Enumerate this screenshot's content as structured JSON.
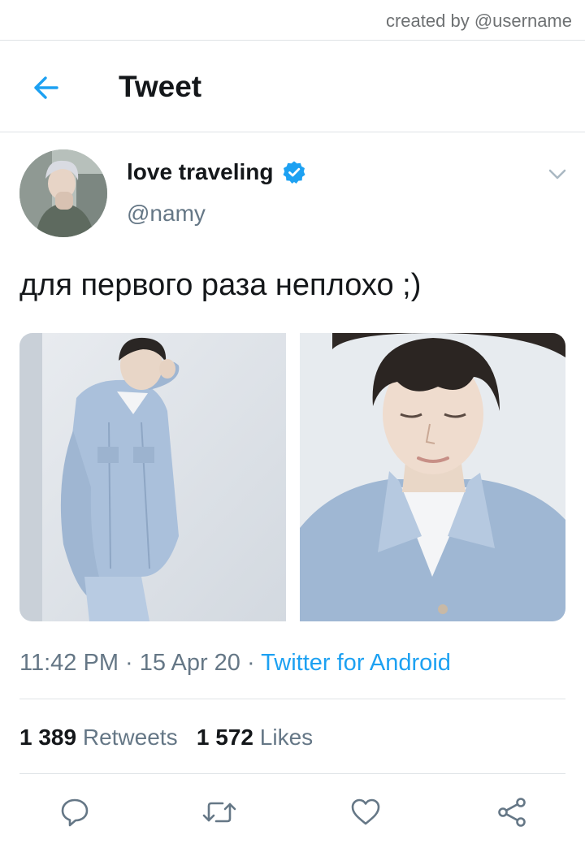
{
  "watermark": "created by @username",
  "header": {
    "title": "Tweet"
  },
  "tweet": {
    "display_name": "love traveling",
    "handle": "@namy",
    "text": "для первого раза неплохо ;)",
    "time": "11:42 PM",
    "date": "15 Apr 20",
    "source": "Twitter for Android",
    "separator": " · "
  },
  "stats": {
    "retweets_count": "1 389",
    "retweets_label": "Retweets",
    "likes_count": "1 572",
    "likes_label": "Likes"
  },
  "colors": {
    "accent": "#1da1f2",
    "secondary_text": "#657786",
    "divider": "#dfe3e6",
    "verified": "#1da1f2"
  },
  "icons": {
    "back": "arrow-left-icon",
    "verified": "verified-badge-icon",
    "caret": "chevron-down-icon",
    "reply": "reply-icon",
    "retweet": "retweet-icon",
    "like": "heart-icon",
    "share": "share-icon"
  }
}
